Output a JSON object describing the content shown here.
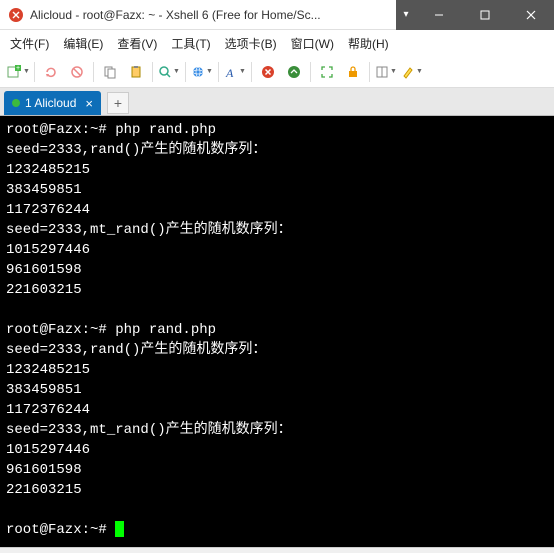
{
  "window": {
    "title": "Alicloud - root@Fazx: ~ - Xshell 6 (Free for Home/Sc..."
  },
  "menu": {
    "file": "文件(F)",
    "edit": "编辑(E)",
    "view": "查看(V)",
    "tools": "工具(T)",
    "tab": "选项卡(B)",
    "window": "窗口(W)",
    "help": "帮助(H)"
  },
  "tab": {
    "label": "1 Alicloud",
    "add": "+"
  },
  "terminal": {
    "lines": [
      "root@Fazx:~# php rand.php",
      "seed=2333,rand()产生的随机数序列：",
      "1232485215",
      "383459851",
      "1172376244",
      "seed=2333,mt_rand()产生的随机数序列：",
      "1015297446",
      "961601598",
      "221603215",
      "",
      "root@Fazx:~# php rand.php",
      "seed=2333,rand()产生的随机数序列：",
      "1232485215",
      "383459851",
      "1172376244",
      "seed=2333,mt_rand()产生的随机数序列：",
      "1015297446",
      "961601598",
      "221603215",
      ""
    ],
    "prompt": "root@Fazx:~# "
  },
  "icons": {
    "app": "xshell"
  }
}
